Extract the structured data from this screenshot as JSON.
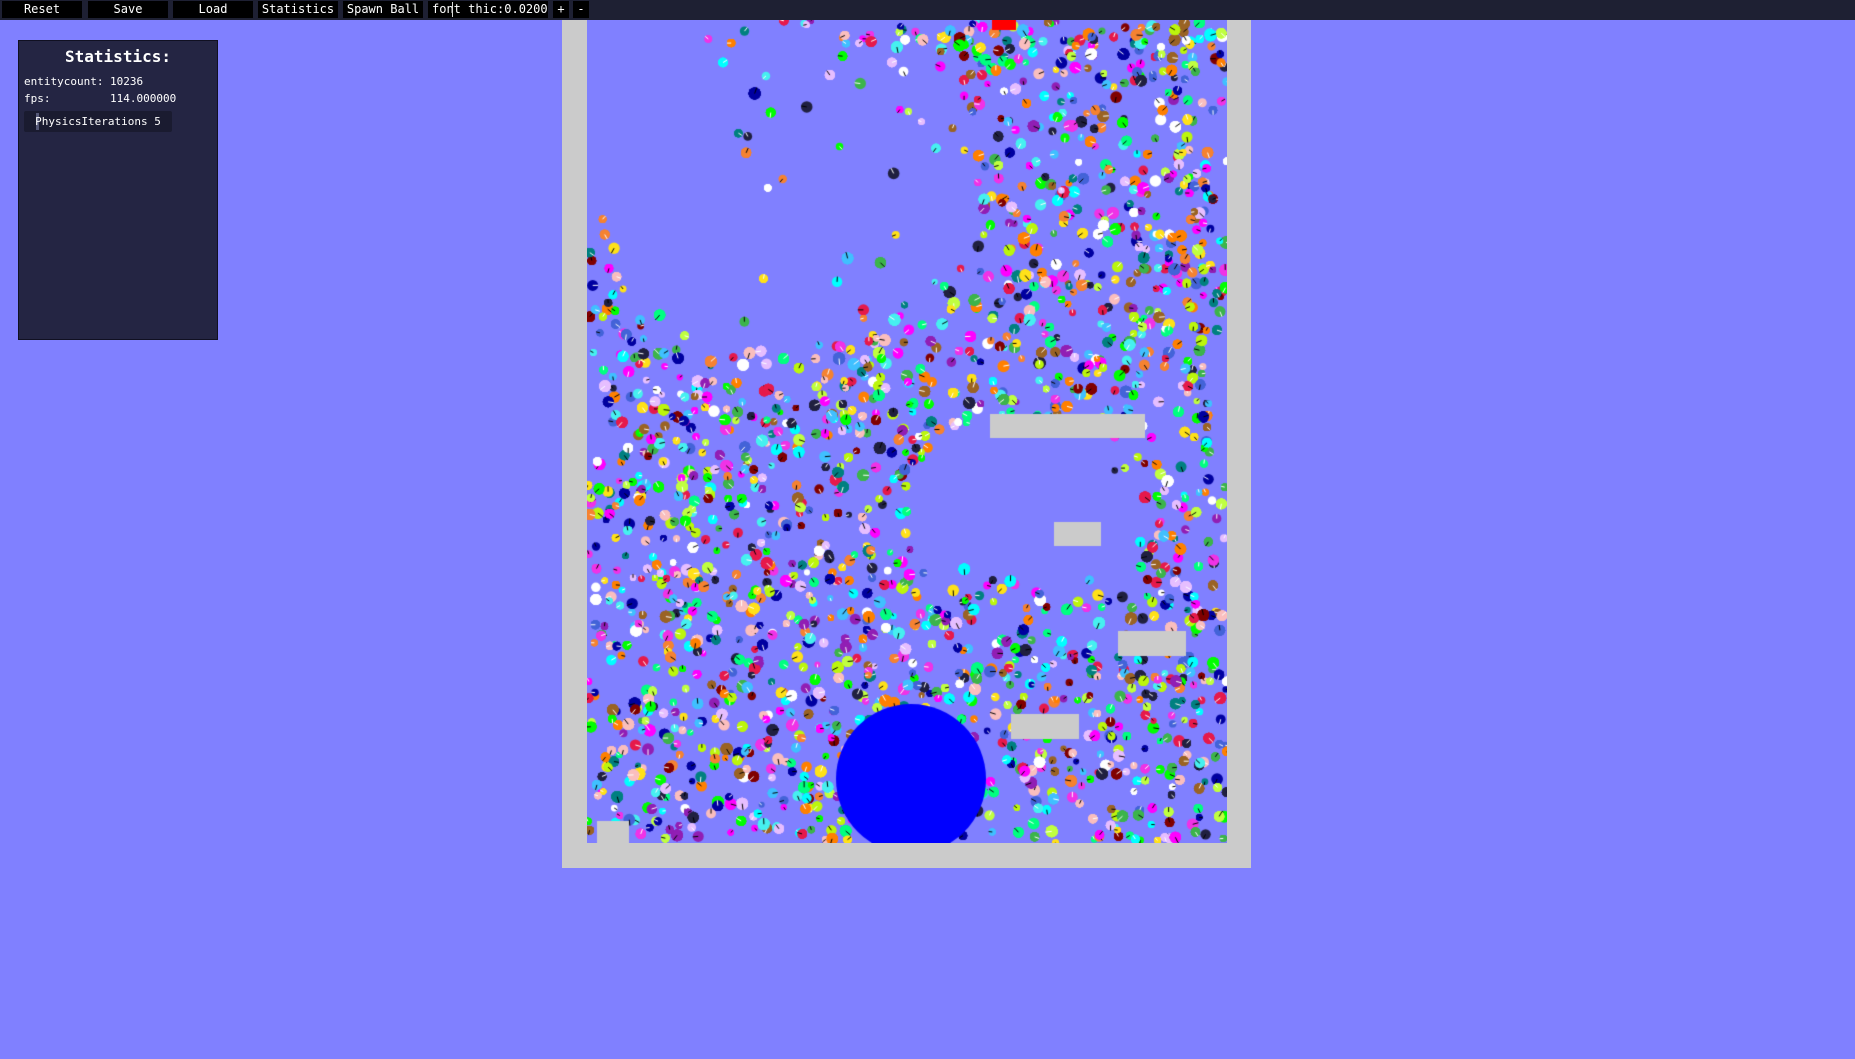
{
  "toolbar": {
    "reset_label": "Reset",
    "save_label": "Save",
    "load_label": "Load",
    "statistics_label": "Statistics",
    "spawn_ball_label": "Spawn Ball",
    "font_thic_value": "font thic:0.02000",
    "plus_label": "+",
    "minus_label": "-"
  },
  "stats_panel": {
    "title": "Statistics:",
    "entitycount_label": "entitycount:",
    "entitycount_value": "10236",
    "fps_label": "fps:",
    "fps_value": "114.000000",
    "physics_iterations_label": "PhysicsIterations 5",
    "physics_iterations_value": 5
  },
  "simulation": {
    "background_color": "#8080ff",
    "frame_color": "#cbcbcb",
    "large_ball_color": "#0000ff",
    "spawn_marker_color": "#ff0000",
    "particle_colors": [
      "#e6194b",
      "#3cb44b",
      "#ffe119",
      "#4363d8",
      "#f58231",
      "#911eb4",
      "#46f0f0",
      "#f032e6",
      "#bcf60c",
      "#fabebe",
      "#008080",
      "#e6beff",
      "#9a6324",
      "#00ff80",
      "#800000",
      "#00ffff",
      "#ff00ff",
      "#00ff00",
      "#ff8000",
      "#0000a0",
      "#202040",
      "#ffffff",
      "#40c0ff",
      "#c0ff40"
    ]
  }
}
